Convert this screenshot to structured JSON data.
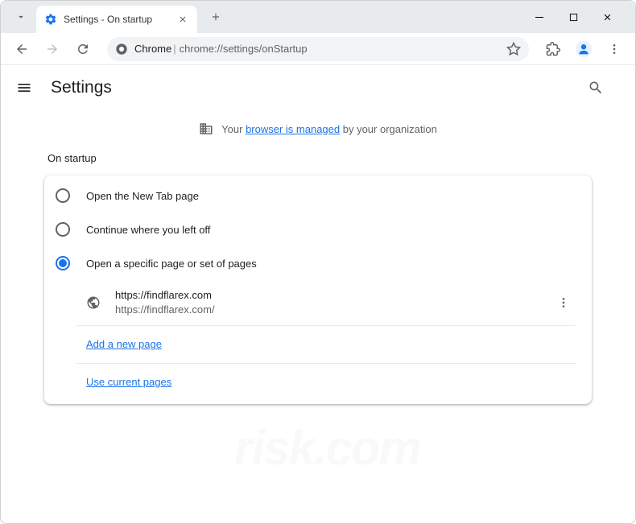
{
  "window": {
    "tab_title": "Settings - On startup",
    "url_label": "Chrome",
    "url": "chrome://settings/onStartup"
  },
  "header": {
    "title": "Settings"
  },
  "banner": {
    "prefix": "Your ",
    "link": "browser is managed",
    "suffix": " by your organization"
  },
  "startup": {
    "section_title": "On startup",
    "options": [
      {
        "label": "Open the New Tab page",
        "checked": false
      },
      {
        "label": "Continue where you left off",
        "checked": false
      },
      {
        "label": "Open a specific page or set of pages",
        "checked": true
      }
    ],
    "pages": [
      {
        "title": "https://findflarex.com",
        "url": "https://findflarex.com/"
      }
    ],
    "add_page_label": "Add a new page",
    "use_current_label": "Use current pages"
  }
}
